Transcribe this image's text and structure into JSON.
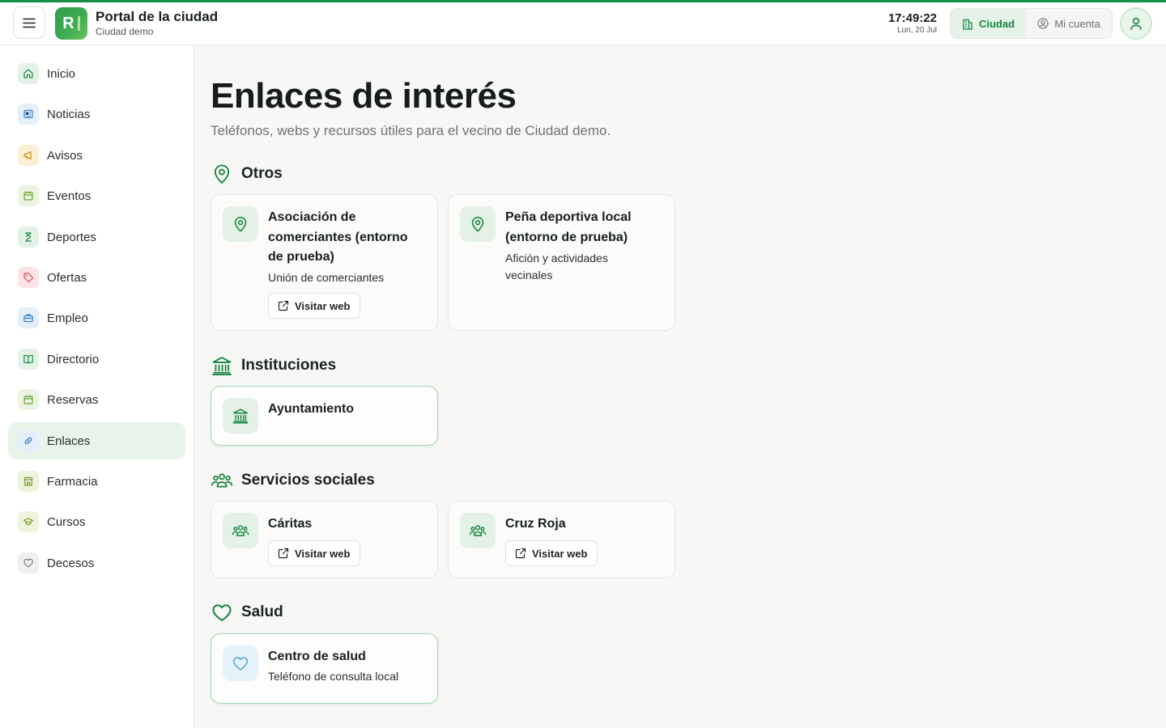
{
  "header": {
    "title": "Portal de la ciudad",
    "subtitle": "Ciudad demo",
    "logo_letter": "R",
    "time": "17:49:22",
    "date": "Lun, 20 Jul",
    "switch": {
      "city_label": "Ciudad",
      "account_label": "Mi cuenta"
    }
  },
  "sidebar": {
    "items": [
      {
        "label": "Inicio",
        "icon": "home-icon",
        "color": "#1f8a4c"
      },
      {
        "label": "Noticias",
        "icon": "newspaper-icon",
        "color": "#3b82c4"
      },
      {
        "label": "Avisos",
        "icon": "megaphone-icon",
        "color": "#c98a12"
      },
      {
        "label": "Eventos",
        "icon": "calendar-icon",
        "color": "#6aa33a"
      },
      {
        "label": "Deportes",
        "icon": "trophy-icon",
        "color": "#1f8a4c"
      },
      {
        "label": "Ofertas",
        "icon": "tag-icon",
        "color": "#d84a5b"
      },
      {
        "label": "Empleo",
        "icon": "briefcase-icon",
        "color": "#3b82c4"
      },
      {
        "label": "Directorio",
        "icon": "book-icon",
        "color": "#1f8a4c"
      },
      {
        "label": "Reservas",
        "icon": "calendar-icon",
        "color": "#6aa33a"
      },
      {
        "label": "Enlaces",
        "icon": "link-icon",
        "color": "#3b82c4"
      },
      {
        "label": "Farmacia",
        "icon": "store-icon",
        "color": "#7d9a2e"
      },
      {
        "label": "Cursos",
        "icon": "graduation-cap-icon",
        "color": "#7d9a2e"
      },
      {
        "label": "Decesos",
        "icon": "heart-icon",
        "color": "#7a7f7c"
      }
    ],
    "active": "Enlaces"
  },
  "main": {
    "title": "Enlaces de interés",
    "subtitle": "Teléfonos, webs y recursos útiles para el vecino de Ciudad demo.",
    "visit_label": "Visitar web",
    "sections": [
      {
        "title": "Otros",
        "icon": "map-pin-icon",
        "cards": [
          {
            "title": "Asociación de comerciantes (entorno de prueba)",
            "description": "Unión de comerciantes",
            "has_link": true
          },
          {
            "title": "Peña deportiva local (entorno de prueba)",
            "description": "Afición y actividades vecinales",
            "has_link": false
          }
        ]
      },
      {
        "title": "Instituciones",
        "icon": "institution-icon",
        "cards": [
          {
            "title": "Ayuntamiento",
            "description": "",
            "has_link": false
          }
        ]
      },
      {
        "title": "Servicios sociales",
        "icon": "people-icon",
        "cards": [
          {
            "title": "Cáritas",
            "description": "",
            "has_link": true
          },
          {
            "title": "Cruz Roja",
            "description": "",
            "has_link": true
          }
        ]
      },
      {
        "title": "Salud",
        "icon": "heart-icon",
        "cards": [
          {
            "title": "Centro de salud",
            "description": "Teléfono de consulta local",
            "has_link": false
          }
        ]
      }
    ]
  },
  "colors": {
    "brand": "#17904a",
    "active_bg": "#e8f3ea",
    "accent_text": "#17863f"
  }
}
